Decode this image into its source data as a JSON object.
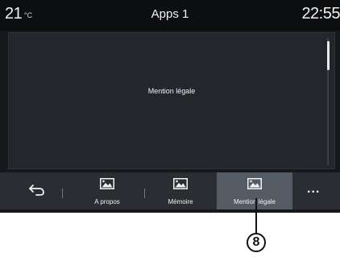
{
  "status_bar": {
    "temperature": "21",
    "temperature_unit": "°C",
    "title": "Apps 1",
    "time": "22:55"
  },
  "content": {
    "text": "Mention légale"
  },
  "bottom_bar": {
    "back_icon": "back-arrow-icon",
    "items": [
      {
        "label": "A propos",
        "icon": "image-icon"
      },
      {
        "label": "Mémoire",
        "icon": "image-icon"
      },
      {
        "label": "Mention légale",
        "icon": "image-icon",
        "active": true
      }
    ],
    "more_label": "..."
  },
  "callout": {
    "number": "8"
  },
  "colors": {
    "screen_background": "#16181b",
    "panel_background": "#23262a",
    "bar_background": "#2a2d31",
    "active_tab": "#545b64"
  }
}
